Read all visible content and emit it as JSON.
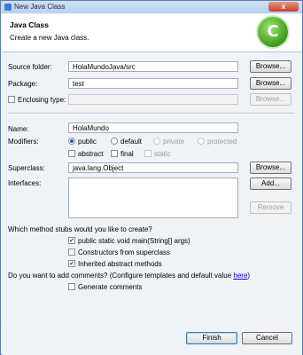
{
  "window": {
    "title": "New Java Class"
  },
  "header": {
    "title": "Java Class",
    "description": "Create a new Java class."
  },
  "form": {
    "source_folder": {
      "label": "Source folder:",
      "value": "HolaMundoJava/src",
      "button": "Browse..."
    },
    "package": {
      "label": "Package:",
      "value": "test",
      "button": "Browse..."
    },
    "enclosing_type": {
      "label": "Enclosing type:",
      "value": "",
      "button": "Browse..."
    },
    "name": {
      "label": "Name:",
      "value": "HolaMundo"
    },
    "modifiers": {
      "label": "Modifiers:",
      "visibility": [
        {
          "label": "public",
          "selected": true
        },
        {
          "label": "default",
          "selected": false
        },
        {
          "label": "private",
          "selected": false
        },
        {
          "label": "protected",
          "selected": false
        }
      ],
      "options": [
        {
          "label": "abstract",
          "checked": false
        },
        {
          "label": "final",
          "checked": false
        },
        {
          "label": "static",
          "checked": false
        }
      ]
    },
    "superclass": {
      "label": "Superclass:",
      "value": "java.lang.Object",
      "button": "Browse..."
    },
    "interfaces": {
      "label": "Interfaces:",
      "add_button": "Add...",
      "remove_button": "Remove"
    }
  },
  "stubs": {
    "question": "Which method stubs would you like to create?",
    "items": [
      {
        "label": "public static void main(String[] args)",
        "checked": true
      },
      {
        "label": "Constructors from superclass",
        "checked": false
      },
      {
        "label": "Inherited abstract methods",
        "checked": true
      }
    ]
  },
  "comments": {
    "question": "Do you want to add comments? (Configure templates and default value ",
    "link": "here",
    "close_paren": ")",
    "item": {
      "label": "Generate comments",
      "checked": false
    }
  },
  "footer": {
    "finish": "Finish",
    "cancel": "Cancel"
  },
  "icons": {
    "close": "close-icon",
    "logo": "new-class-wizard-icon",
    "check": "✔",
    "close_glyph": "x",
    "logo_glyph": "C"
  }
}
